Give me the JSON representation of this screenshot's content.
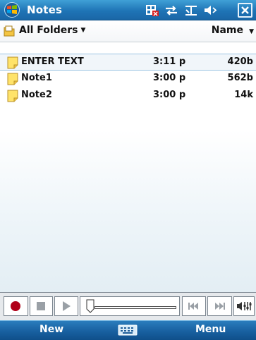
{
  "titlebar": {
    "app_title": "Notes"
  },
  "folderbar": {
    "folder_label": "All Folders",
    "sort_label": "Name"
  },
  "notes": [
    {
      "name": "ENTER TEXT",
      "time": "3:11 p",
      "size": "420b",
      "selected": true
    },
    {
      "name": "Note1",
      "time": "3:00 p",
      "size": "562b"
    },
    {
      "name": "Note2",
      "time": "3:00 p",
      "size": "14k"
    }
  ],
  "softkeys": {
    "left": "New",
    "right": "Menu"
  },
  "icons": [
    "windows-start-icon",
    "sim-card-icon",
    "connectivity-icon",
    "signal-icon",
    "volume-icon",
    "close-icon",
    "folder-icon",
    "note-icon",
    "record-icon",
    "stop-icon",
    "play-icon",
    "slider-thumb-icon",
    "previous-icon",
    "next-icon",
    "recorder-volume-icon",
    "keyboard-icon"
  ],
  "colors": {
    "titlebar": "#1f74b6",
    "selection": "#9bc4e3",
    "record": "#b00018",
    "note_yellow": "#ffe36a"
  }
}
